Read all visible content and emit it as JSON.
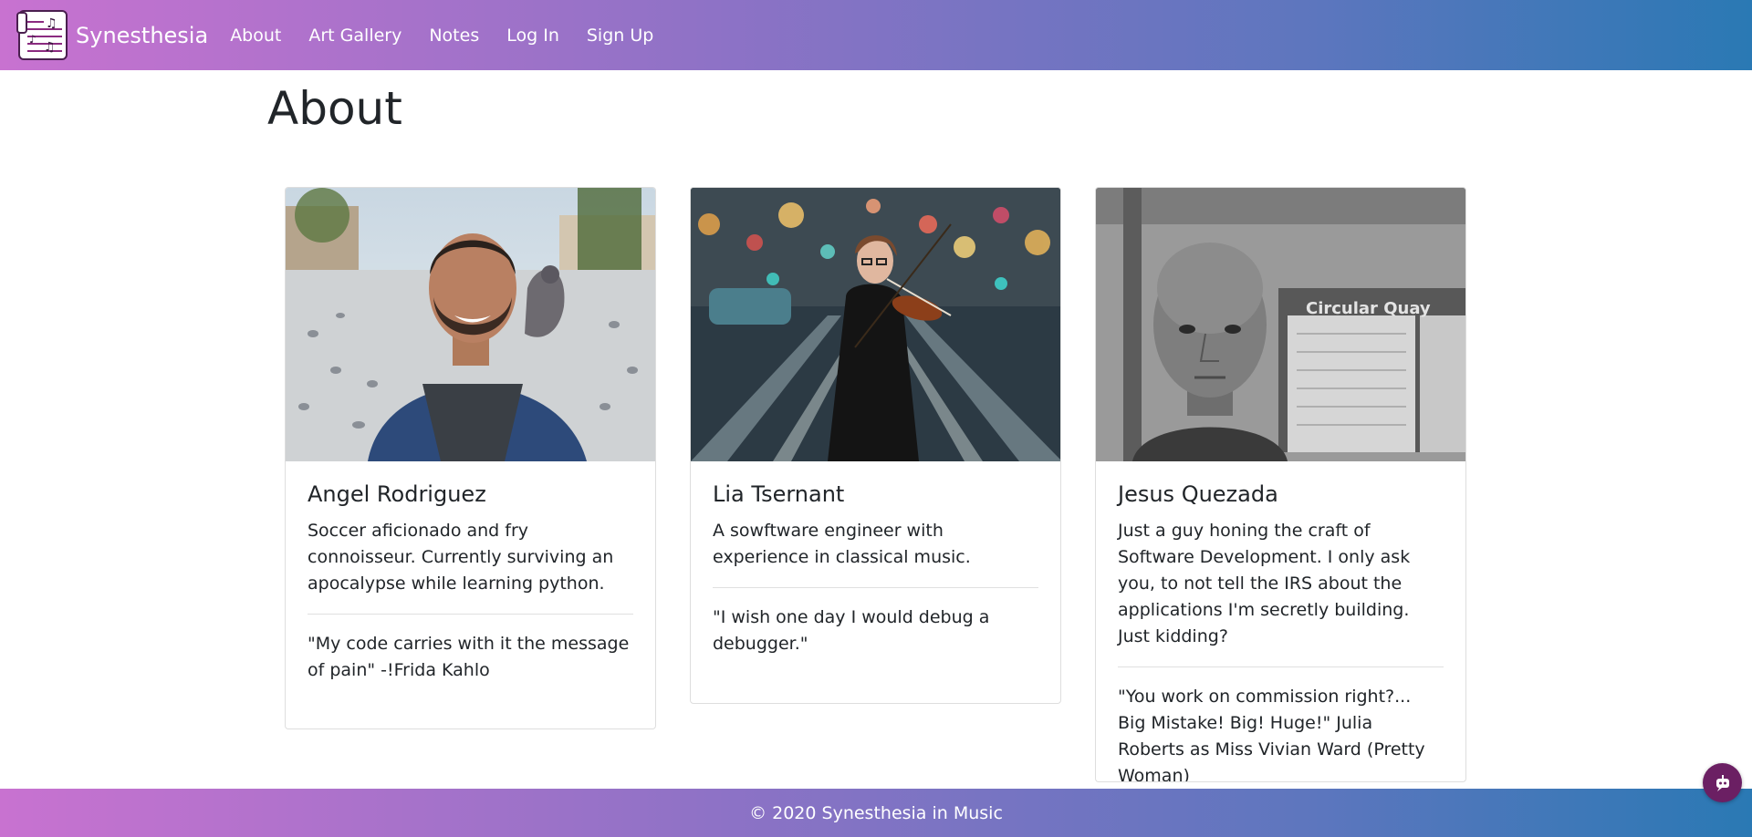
{
  "navbar": {
    "brand": "Synesthesia",
    "links": [
      "About",
      "Art Gallery",
      "Notes",
      "Log In",
      "Sign Up"
    ]
  },
  "page": {
    "title": "About"
  },
  "cards": [
    {
      "name": "Angel Rodriguez",
      "bio": "Soccer aficionado and fry connoisseur. Currently surviving an apocalypse while learning python.",
      "quote": "\"My code carries with it the message of pain\" -!Frida Kahlo",
      "photo": "portrait-man-with-pigeons"
    },
    {
      "name": "Lia Tsernant",
      "bio": "A sowftware engineer with experience in classical music.",
      "quote": "\"I wish one day I would debug a debugger.\"",
      "photo": "woman-playing-violin-on-street"
    },
    {
      "name": "Jesus Quezada",
      "bio": "Just a guy honing the craft of Software Development. I only ask you, to not tell the IRS about the applications I'm secretly building. Just kidding?",
      "quote": "\"You work on commission right?... Big Mistake! Big! Huge!\" Julia Roberts as Miss Vivian Ward (Pretty Woman)",
      "photo": "grayscale-man-circular-quay",
      "photo_sign": "Circular Quay"
    }
  ],
  "footer": {
    "text": "© 2020 Synesthesia in Music"
  },
  "colors": {
    "gradient_start": "#c872d0",
    "gradient_end": "#2a79b4",
    "chat_button": "#6b1f63"
  },
  "icons": {
    "logo": "music-notes-logo-icon",
    "chat": "chat-bot-icon"
  }
}
